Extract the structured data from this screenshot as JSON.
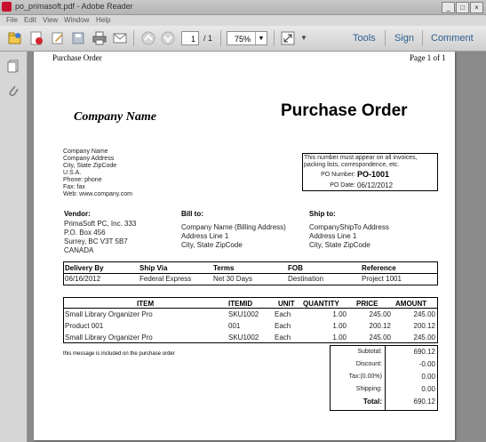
{
  "window": {
    "title": "po_primasoft.pdf - Adobe Reader",
    "minimize_label": "_",
    "maximize_label": "□",
    "close_label": "×"
  },
  "menu": [
    "File",
    "Edit",
    "View",
    "Window",
    "Help"
  ],
  "toolbar": {
    "page_current": "1",
    "page_total": "/ 1",
    "zoom": "75%",
    "tools_label": "Tools",
    "sign_label": "Sign",
    "comment_label": "Comment"
  },
  "document": {
    "header_left": "Purchase Order",
    "header_right": "Page 1 of 1",
    "company_name": "Company Name",
    "title": "Purchase Order",
    "company_address": [
      "Company Name",
      "Company Address",
      "City, State ZipCode",
      "U.S.A.",
      "Phone: phone",
      "Fax: fax",
      "Web: www.company.com"
    ],
    "notice": "This number must appear on all invoices, packing lists, correspondence, etc.",
    "notice_line1": "This number must appear on all invoices,",
    "notice_line2": "packing lists, correspondence, etc.",
    "po_number_label": "PO Number:",
    "po_number": "PO-1001",
    "po_date_label": "PO Date:",
    "po_date": "06/12/2012",
    "vendor_label": "Vendor:",
    "vendor": [
      "PrimaSoft PC, Inc. 333",
      "P.O. Box 456",
      "Surrey, BC V3T 5B7",
      "CANADA"
    ],
    "bill_to_label": "Bill to:",
    "bill_to": [
      "Company Name (Billing Address)",
      "Address Line 1",
      "City, State ZipCode"
    ],
    "ship_to_label": "Ship to:",
    "ship_to": [
      "CompanyShipTo Address",
      "Address Line 1",
      "City, State ZipCode"
    ],
    "terms_headers": [
      "Delivery By",
      "Ship Via",
      "Terms",
      "FOB",
      "Reference"
    ],
    "terms_values": [
      "06/16/2012",
      "Federal Express",
      "Net 30 Days",
      "Destination",
      "Project 1001"
    ],
    "item_headers": [
      "ITEM",
      "ITEMID",
      "UNIT",
      "QUANTITY",
      "PRICE",
      "AMOUNT"
    ],
    "items": [
      [
        "Small Library Organizer Pro",
        "SKU1002",
        "Each",
        "1.00",
        "245.00",
        "245.00"
      ],
      [
        "Product 001",
        "001",
        "Each",
        "1.00",
        "200.12",
        "200.12"
      ],
      [
        "Small Library Organizer Pro",
        "SKU1002",
        "Each",
        "1.00",
        "245.00",
        "245.00"
      ]
    ],
    "message": "this message is included on the purchase order",
    "totals": [
      [
        "Subtotal:",
        "690.12"
      ],
      [
        "Discount:",
        "-0.00"
      ],
      [
        "Tax:(0.00%)",
        "0.00"
      ],
      [
        "Shipping:",
        "0.00"
      ],
      [
        "Total:",
        "690.12"
      ]
    ]
  }
}
